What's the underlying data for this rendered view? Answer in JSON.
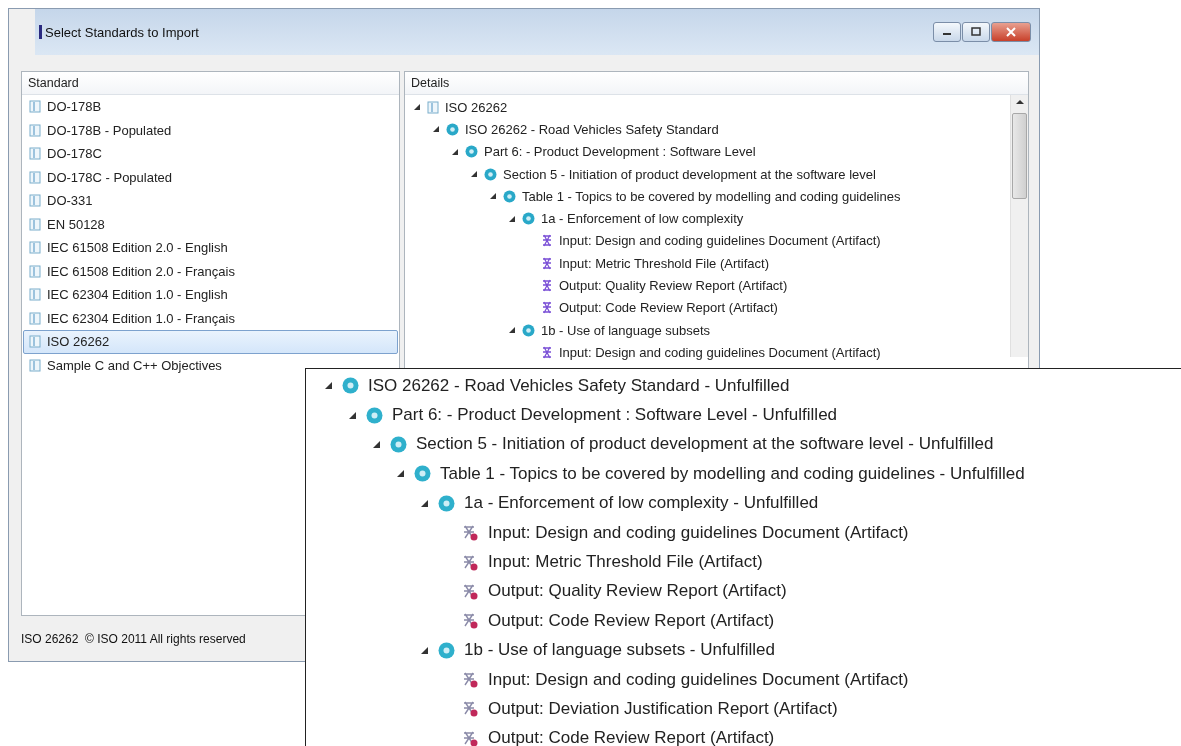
{
  "window": {
    "title": "Select Standards to Import"
  },
  "standards": {
    "header": "Standard",
    "items": [
      {
        "label": "DO-178B",
        "selected": false
      },
      {
        "label": "DO-178B - Populated",
        "selected": false
      },
      {
        "label": "DO-178C",
        "selected": false
      },
      {
        "label": "DO-178C - Populated",
        "selected": false
      },
      {
        "label": "DO-331",
        "selected": false
      },
      {
        "label": "EN 50128",
        "selected": false
      },
      {
        "label": "IEC 61508 Edition 2.0 - English",
        "selected": false
      },
      {
        "label": "IEC 61508 Edition 2.0 - Français",
        "selected": false
      },
      {
        "label": "IEC 62304 Edition 1.0 - English",
        "selected": false
      },
      {
        "label": "IEC 62304 Edition 1.0 - Français",
        "selected": false
      },
      {
        "label": "ISO 26262",
        "selected": true
      },
      {
        "label": "Sample C and C++ Objectives",
        "selected": false
      }
    ]
  },
  "details": {
    "header": "Details",
    "tree": [
      {
        "kind": "document",
        "label": "ISO 26262",
        "expanded": true,
        "children": [
          {
            "kind": "objective",
            "label": "ISO 26262 - Road Vehicles Safety Standard",
            "expanded": true,
            "children": [
              {
                "kind": "objective",
                "label": "Part 6: - Product Development : Software Level",
                "expanded": true,
                "children": [
                  {
                    "kind": "objective",
                    "label": "Section 5 - Initiation of product development at the software level",
                    "expanded": true,
                    "children": [
                      {
                        "kind": "objective",
                        "label": "Table 1 - Topics to be covered by modelling and coding guidelines",
                        "expanded": true,
                        "children": [
                          {
                            "kind": "objective",
                            "label": "1a - Enforcement of low complexity",
                            "expanded": true,
                            "children": [
                              {
                                "kind": "artifact",
                                "label": "Input: Design and coding guidelines Document (Artifact)"
                              },
                              {
                                "kind": "artifact",
                                "label": "Input: Metric Threshold File (Artifact)"
                              },
                              {
                                "kind": "artifact",
                                "label": "Output: Quality Review Report (Artifact)"
                              },
                              {
                                "kind": "artifact",
                                "label": "Output: Code Review Report (Artifact)"
                              }
                            ]
                          },
                          {
                            "kind": "objective",
                            "label": "1b - Use of language subsets",
                            "expanded": true,
                            "children": [
                              {
                                "kind": "artifact",
                                "label": "Input: Design and coding guidelines Document (Artifact)"
                              }
                            ]
                          }
                        ]
                      }
                    ]
                  }
                ]
              }
            ]
          }
        ]
      }
    ]
  },
  "status_bar": {
    "text": "ISO 26262  © ISO 2011 All rights reserved"
  },
  "zoom_panel": {
    "tree": [
      {
        "kind": "objective",
        "label": "ISO 26262 - Road Vehicles Safety Standard - Unfulfilled",
        "expanded": true,
        "children": [
          {
            "kind": "objective",
            "label": "Part 6: - Product Development : Software Level - Unfulfilled",
            "expanded": true,
            "children": [
              {
                "kind": "objective",
                "label": "Section 5 - Initiation of product development at the software level - Unfulfilled",
                "expanded": true,
                "children": [
                  {
                    "kind": "objective",
                    "label": "Table 1 - Topics to be covered by modelling and coding guidelines - Unfulfilled",
                    "expanded": true,
                    "children": [
                      {
                        "kind": "objective",
                        "label": "1a - Enforcement of low complexity - Unfulfilled",
                        "expanded": true,
                        "children": [
                          {
                            "kind": "artifact",
                            "label": "Input: Design and coding guidelines Document (Artifact)"
                          },
                          {
                            "kind": "artifact",
                            "label": "Input: Metric Threshold File (Artifact)"
                          },
                          {
                            "kind": "artifact",
                            "label": "Output: Quality Review Report (Artifact)"
                          },
                          {
                            "kind": "artifact",
                            "label": "Output: Code Review Report (Artifact)"
                          }
                        ]
                      },
                      {
                        "kind": "objective",
                        "label": "1b - Use of language subsets - Unfulfilled",
                        "expanded": true,
                        "children": [
                          {
                            "kind": "artifact",
                            "label": "Input: Design and coding guidelines Document (Artifact)"
                          },
                          {
                            "kind": "artifact",
                            "label": "Output: Deviation Justification Report (Artifact)"
                          },
                          {
                            "kind": "artifact",
                            "label": "Output: Code Review Report (Artifact)"
                          }
                        ]
                      }
                    ]
                  }
                ]
              }
            ]
          }
        ]
      }
    ]
  }
}
